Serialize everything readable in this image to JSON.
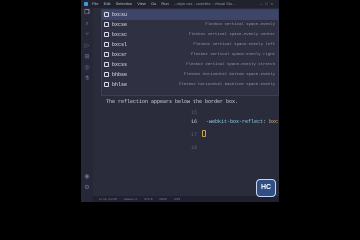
{
  "titlebar": {
    "menus": [
      "File",
      "Edit",
      "Selection",
      "View",
      "Go",
      "Run",
      "..."
    ],
    "window_title": "style.css - codeflex - Visual Stu..."
  },
  "activitybar": {
    "icons": [
      "files-icon",
      "search-icon",
      "source-control-icon",
      "run-debug-icon",
      "extensions-icon",
      "remote-icon",
      "testing-icon",
      "account-icon",
      "settings-icon"
    ]
  },
  "suggest": {
    "items": [
      {
        "label": "bxcsu",
        "detail": ""
      },
      {
        "label": "bxcse",
        "detail": "Flexbox vertical space-evenly"
      },
      {
        "label": "bxcsc",
        "detail": "Flexbox vertical space-evenly center"
      },
      {
        "label": "bxcsl",
        "detail": "Flexbox vertical space-evenly left"
      },
      {
        "label": "bxcsr",
        "detail": "Flexbox vertical space-evenly right"
      },
      {
        "label": "bxcss",
        "detail": "Flexbox vertical space-evenly stretch"
      },
      {
        "label": "bhbse",
        "detail": "Flexbox horizontal bottom space-evenly"
      },
      {
        "label": "bhlse",
        "detail": "Flexbox horizontal baseline space-evenly"
      }
    ],
    "doc": "The reflection appears below the border box."
  },
  "editor": {
    "line_numbers": [
      "15",
      "16",
      "17",
      "18"
    ],
    "current_line": "16",
    "code": {
      "property": "-webkit-box-reflect",
      "colon": ": ",
      "value": "bxc",
      "semicolon": ";"
    }
  },
  "statusbar": {
    "items": [
      "Ln 16, Col 25",
      "Spaces: 2",
      "UTF-8",
      "CRLF",
      "CSS"
    ]
  },
  "brand": {
    "logo_text": "HC"
  }
}
